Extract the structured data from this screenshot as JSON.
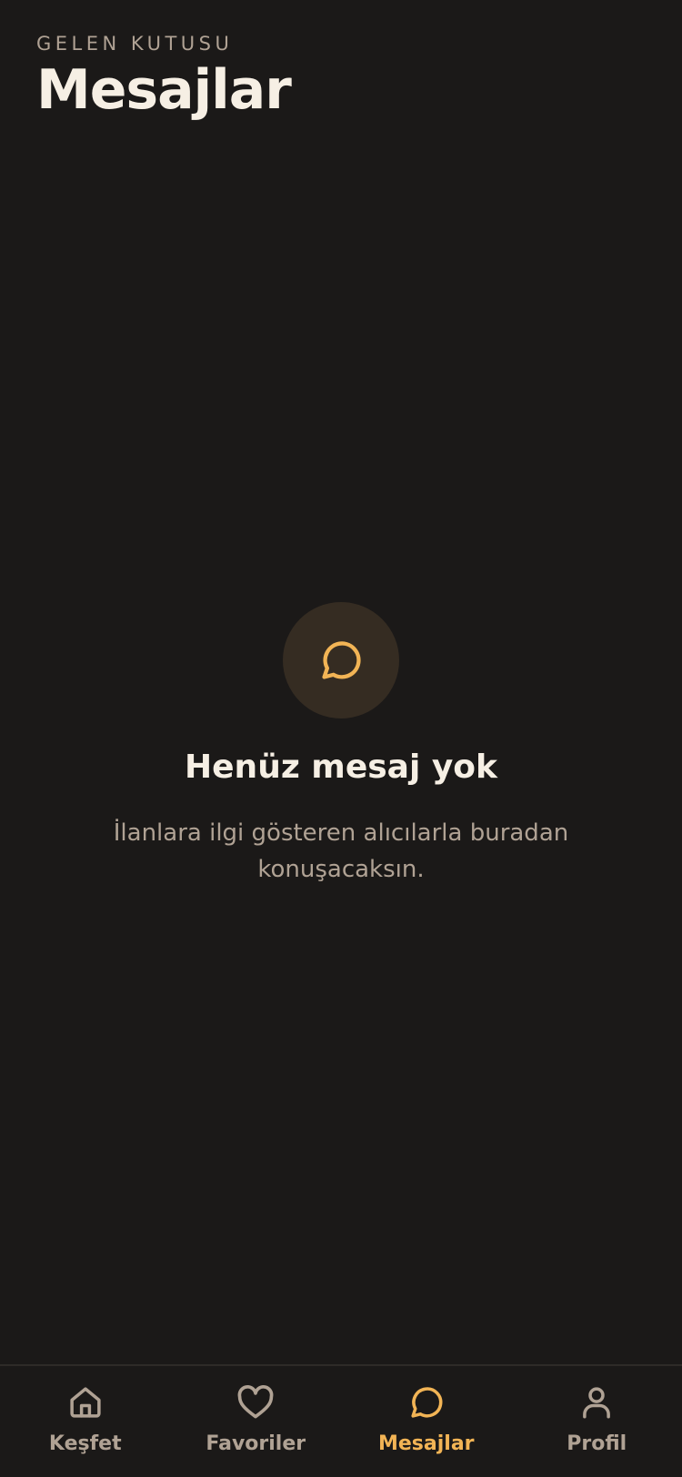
{
  "header": {
    "eyebrow": "GELEN KUTUSU",
    "title": "Mesajlar"
  },
  "empty_state": {
    "icon": "chat-bubble-icon",
    "title": "Henüz mesaj yok",
    "description": "İlanlara ilgi gösteren alıcılarla buradan konuşacaksın."
  },
  "tabs": [
    {
      "label": "Keşfet",
      "icon": "home-icon",
      "active": false
    },
    {
      "label": "Favoriler",
      "icon": "heart-icon",
      "active": false
    },
    {
      "label": "Mesajlar",
      "icon": "chat-bubble-icon",
      "active": true
    },
    {
      "label": "Profil",
      "icon": "user-icon",
      "active": false
    }
  ],
  "colors": {
    "background": "#1b1918",
    "accent": "#f2b455",
    "muted_text": "#b0a294",
    "primary_text": "#f6efe4",
    "icon_circle": "#352c22"
  }
}
